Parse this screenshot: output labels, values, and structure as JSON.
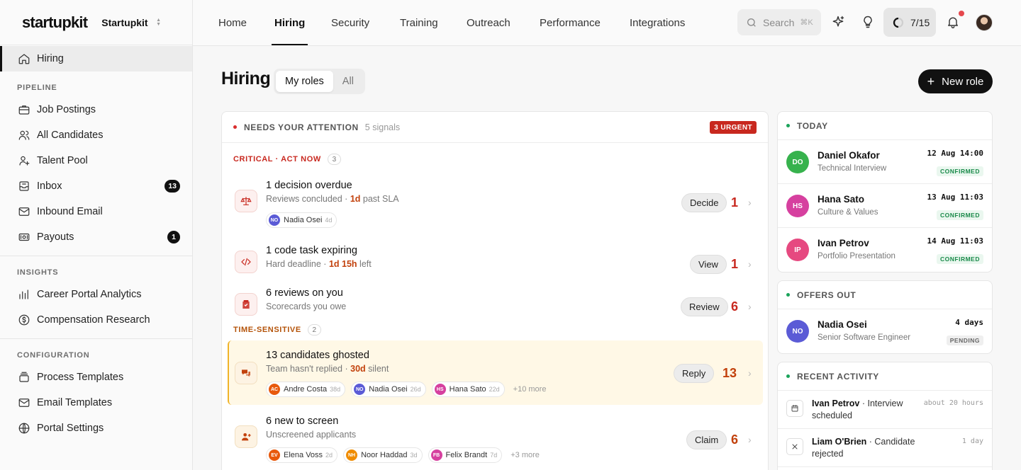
{
  "brand": {
    "logo": "startupkit",
    "workspace": "Startupkit"
  },
  "sidebar": {
    "active": {
      "label": "Hiring",
      "icon": "home-icon"
    },
    "sections": [
      {
        "title": "PIPELINE",
        "items": [
          {
            "label": "Job Postings",
            "icon": "briefcase-icon"
          },
          {
            "label": "All Candidates",
            "icon": "users-icon"
          },
          {
            "label": "Talent Pool",
            "icon": "user-plus-icon"
          },
          {
            "label": "Inbox",
            "icon": "inbox-icon",
            "badge": "13"
          },
          {
            "label": "Inbound Email",
            "icon": "mail-icon"
          },
          {
            "label": "Payouts",
            "icon": "cash-icon",
            "badge": "1"
          }
        ]
      },
      {
        "title": "INSIGHTS",
        "items": [
          {
            "label": "Career Portal Analytics",
            "icon": "bar-chart-icon"
          },
          {
            "label": "Compensation Research",
            "icon": "dollar-icon"
          }
        ]
      },
      {
        "title": "CONFIGURATION",
        "items": [
          {
            "label": "Process Templates",
            "icon": "stack-icon"
          },
          {
            "label": "Email Templates",
            "icon": "mail-icon"
          },
          {
            "label": "Portal Settings",
            "icon": "globe-icon"
          }
        ]
      }
    ]
  },
  "topnav": {
    "tabs": [
      "Home",
      "Hiring",
      "Security",
      "Training",
      "Outreach",
      "Performance",
      "Integrations"
    ],
    "active_tab": "Hiring",
    "search_placeholder": "Search",
    "search_shortcut": "⌘K",
    "progress": "7/15"
  },
  "header": {
    "title": "Hiring",
    "seg_options": [
      "My roles",
      "All"
    ],
    "new_role": "New role"
  },
  "attention": {
    "title": "NEEDS YOUR ATTENTION",
    "signals": "5 signals",
    "urgent": "3 URGENT",
    "critical_label": "CRITICAL · ACT NOW",
    "critical_count": "3",
    "timesensitive_label": "TIME-SENSITIVE",
    "timesensitive_count": "2",
    "rows": [
      {
        "title": "1 decision overdue",
        "sub_pre": "Reviews concluded · ",
        "sub_hl": "1d",
        "sub_post": " past SLA",
        "action": "Decide",
        "count": "1",
        "icon": "scale-icon",
        "chips": [
          {
            "initials": "NO",
            "name": "Nadia Osei",
            "age": "4d",
            "color": "#5b5bd6"
          }
        ],
        "more": ""
      },
      {
        "title": "1 code task expiring",
        "sub_pre": "Hard deadline · ",
        "sub_hl": "1d 15h",
        "sub_post": " left",
        "action": "View",
        "count": "1",
        "icon": "code-icon",
        "chips": [],
        "more": ""
      },
      {
        "title": "6 reviews on you",
        "sub_pre": "Scorecards you owe",
        "sub_hl": "",
        "sub_post": "",
        "action": "Review",
        "count": "6",
        "icon": "clipboard-check-icon",
        "chips": [],
        "more": ""
      },
      {
        "title": "13 candidates ghosted",
        "sub_pre": "Team hasn't replied · ",
        "sub_hl": "30d",
        "sub_post": " silent",
        "action": "Reply",
        "count": "13",
        "icon": "chat-icon",
        "chips": [
          {
            "initials": "AC",
            "name": "Andre Costa",
            "age": "38d",
            "color": "#e8590c"
          },
          {
            "initials": "NO",
            "name": "Nadia Osei",
            "age": "26d",
            "color": "#5b5bd6"
          },
          {
            "initials": "HS",
            "name": "Hana Sato",
            "age": "22d",
            "color": "#d6409f"
          }
        ],
        "more": "+10 more"
      },
      {
        "title": "6 new to screen",
        "sub_pre": "Unscreened applicants",
        "sub_hl": "",
        "sub_post": "",
        "action": "Claim",
        "count": "6",
        "icon": "user-add-icon",
        "chips": [
          {
            "initials": "EV",
            "name": "Elena Voss",
            "age": "2d",
            "color": "#e8590c"
          },
          {
            "initials": "NH",
            "name": "Noor Haddad",
            "age": "3d",
            "color": "#f08c00"
          },
          {
            "initials": "FB",
            "name": "Felix Brandt",
            "age": "7d",
            "color": "#d6409f"
          }
        ],
        "more": "+3 more"
      }
    ]
  },
  "today": {
    "title": "TODAY",
    "items": [
      {
        "initials": "DO",
        "name": "Daniel Okafor",
        "role": "Technical Interview",
        "time": "12 Aug 14:00",
        "status": "CONFIRMED",
        "color": "#37b24d"
      },
      {
        "initials": "HS",
        "name": "Hana Sato",
        "role": "Culture & Values",
        "time": "13 Aug 11:03",
        "status": "CONFIRMED",
        "color": "#d6409f"
      },
      {
        "initials": "IP",
        "name": "Ivan Petrov",
        "role": "Portfolio Presentation",
        "time": "14 Aug 11:03",
        "status": "CONFIRMED",
        "color": "#e64980"
      }
    ]
  },
  "offers": {
    "title": "OFFERS OUT",
    "items": [
      {
        "initials": "NO",
        "name": "Nadia Osei",
        "role": "Senior Software Engineer",
        "time": "4 days",
        "status": "PENDING",
        "color": "#5b5bd6"
      }
    ]
  },
  "activity": {
    "title": "RECENT ACTIVITY",
    "items": [
      {
        "who": "Ivan Petrov",
        "what": " · Interview scheduled",
        "time": "about 20 hours",
        "icon": "calendar-icon"
      },
      {
        "who": "Liam O'Brien",
        "what": " · Candidate rejected",
        "time": "1 day",
        "icon": "x-icon"
      }
    ]
  }
}
